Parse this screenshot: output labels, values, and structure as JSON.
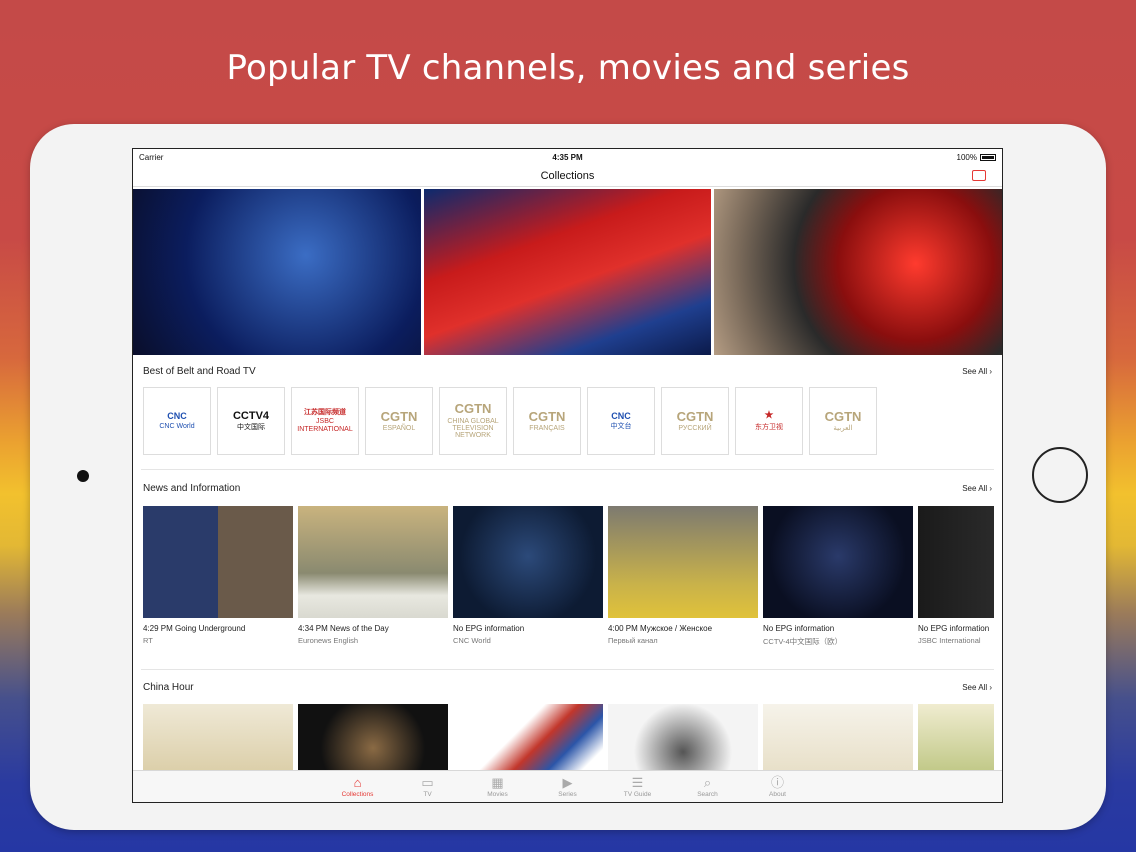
{
  "headline": "Popular TV channels, movies and series",
  "status": {
    "carrier": "Carrier",
    "time": "4:35 PM",
    "battery": "100%"
  },
  "nav": {
    "title": "Collections"
  },
  "sections": {
    "belt": {
      "title": "Best of Belt and Road TV",
      "see_all": "See All",
      "channels": [
        {
          "top": "CNC",
          "bottom": "CNC World"
        },
        {
          "top": "CCTV4",
          "bottom": "中文国际"
        },
        {
          "top": "江苏国际频道",
          "bottom": "JSBC INTERNATIONAL"
        },
        {
          "top": "CGTN",
          "bottom": "ESPAÑOL"
        },
        {
          "top": "CGTN",
          "bottom": "CHINA GLOBAL TELEVISION NETWORK"
        },
        {
          "top": "CGTN",
          "bottom": "FRANÇAIS"
        },
        {
          "top": "CNC",
          "bottom": "中文台"
        },
        {
          "top": "CGTN",
          "bottom": "РУССКИЙ"
        },
        {
          "top": "★",
          "bottom": "东方卫视"
        },
        {
          "top": "CGTN",
          "bottom": "العربية"
        }
      ]
    },
    "news": {
      "title": "News and Information",
      "see_all": "See All",
      "items": [
        {
          "title": "4:29 PM  Going Underground",
          "channel": "RT"
        },
        {
          "title": "4:34 PM  News of the Day",
          "channel": "Euronews English"
        },
        {
          "title": "No EPG information",
          "channel": "CNC World"
        },
        {
          "title": "4:00 PM  Мужское / Женское",
          "channel": "Первый канал"
        },
        {
          "title": "No EPG information",
          "channel": "CCTV-4中文国际（欧）"
        },
        {
          "title": "No EPG information",
          "channel": "JSBC International"
        }
      ]
    },
    "china": {
      "title": "China Hour",
      "see_all": "See All"
    }
  },
  "tabs": [
    {
      "label": "Collections",
      "icon": "home-icon",
      "glyph": "⌂"
    },
    {
      "label": "TV",
      "icon": "tv-icon",
      "glyph": "▭"
    },
    {
      "label": "Movies",
      "icon": "film-icon",
      "glyph": "▦"
    },
    {
      "label": "Series",
      "icon": "play-icon",
      "glyph": "▶"
    },
    {
      "label": "TV Guide",
      "icon": "guide-icon",
      "glyph": "☰"
    },
    {
      "label": "Search",
      "icon": "search-icon",
      "glyph": "⌕"
    },
    {
      "label": "About",
      "icon": "info-icon",
      "glyph": "ⓘ"
    }
  ],
  "colors": {
    "accent": "#e53935"
  }
}
